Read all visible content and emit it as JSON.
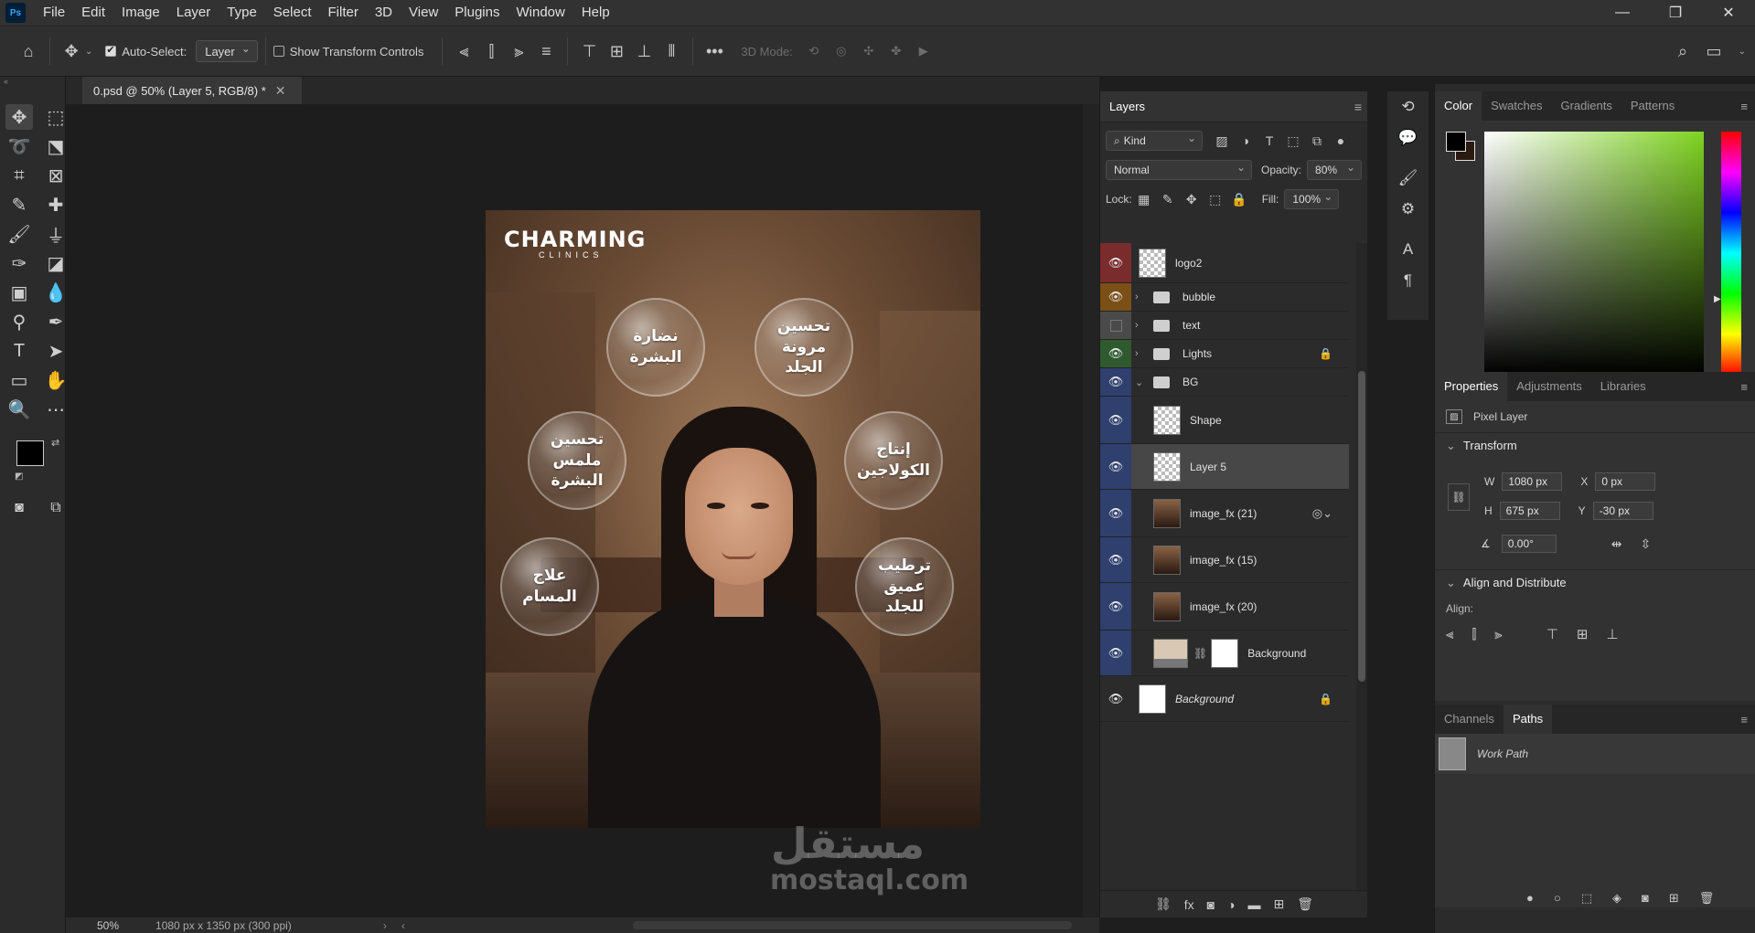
{
  "menubar": {
    "logo": "Ps",
    "items": [
      "File",
      "Edit",
      "Image",
      "Layer",
      "Type",
      "Select",
      "Filter",
      "3D",
      "View",
      "Plugins",
      "Window",
      "Help"
    ]
  },
  "options": {
    "auto_select_label": "Auto-Select:",
    "auto_select_value": "Layer",
    "transform_label": "Show Transform Controls",
    "mode_3d_label": "3D Mode:"
  },
  "document": {
    "tab_title": "0.psd @ 50% (Layer 5, RGB/8) *",
    "zoom": "50%",
    "doc_info": "1080 px x 1350 px (300 ppi)"
  },
  "artwork": {
    "brand_name": "CHARMING",
    "brand_sub": "CLINICS",
    "bubbles": [
      "نضارة البشرة",
      "تحسين مرونة الجلد",
      "تحسين ملمس البشرة",
      "إنتاج الكولاجين",
      "علاج المسام",
      "ترطيب عميق للجلد"
    ],
    "watermark_ar": "مستقل",
    "watermark_en": "mostaql.com"
  },
  "layers_panel": {
    "title": "Layers",
    "filter_kind": "Kind",
    "blend_mode": "Normal",
    "opacity_label": "Opacity:",
    "opacity_value": "80%",
    "lock_label": "Lock:",
    "fill_label": "Fill:",
    "fill_value": "100%",
    "layers": [
      {
        "name": "logo2"
      },
      {
        "name": "bubble"
      },
      {
        "name": "text"
      },
      {
        "name": "Lights"
      },
      {
        "name": "BG"
      },
      {
        "name": "Shape"
      },
      {
        "name": "Layer 5"
      },
      {
        "name": "image_fx (21)"
      },
      {
        "name": "image_fx (15)"
      },
      {
        "name": "image_fx (20)"
      },
      {
        "name": "Background"
      },
      {
        "name": "Background"
      }
    ]
  },
  "color_panel": {
    "tabs": [
      "Color",
      "Swatches",
      "Gradients",
      "Patterns"
    ],
    "fg": "#000000",
    "bg": "#2a1a12"
  },
  "properties_panel": {
    "tabs": [
      "Properties",
      "Adjustments",
      "Libraries"
    ],
    "type_label": "Pixel Layer",
    "transform_title": "Transform",
    "w_label": "W",
    "w_value": "1080 px",
    "x_label": "X",
    "x_value": "0 px",
    "h_label": "H",
    "h_value": "675 px",
    "y_label": "Y",
    "y_value": "-30 px",
    "angle_value": "0.00°",
    "align_title": "Align and Distribute",
    "align_label": "Align:"
  },
  "paths_panel": {
    "tabs": [
      "Channels",
      "Paths"
    ],
    "work_path": "Work Path"
  }
}
